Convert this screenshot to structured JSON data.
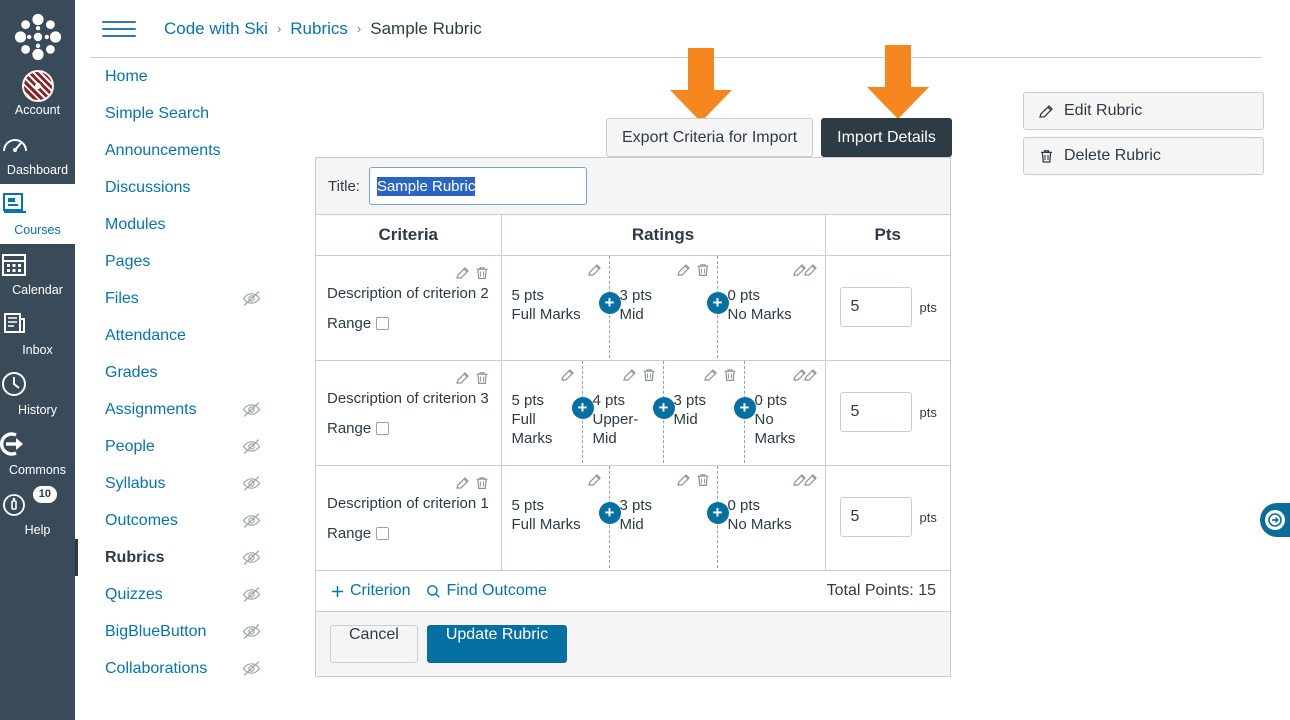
{
  "global_nav": {
    "logo": "canvas-logo",
    "items": [
      {
        "label": "Account",
        "icon": "avatar-icon",
        "active": false,
        "badge": null
      },
      {
        "label": "Dashboard",
        "icon": "dashboard-icon",
        "active": false,
        "badge": null
      },
      {
        "label": "Courses",
        "icon": "courses-icon",
        "active": true,
        "badge": null
      },
      {
        "label": "Calendar",
        "icon": "calendar-icon",
        "active": false,
        "badge": null
      },
      {
        "label": "Inbox",
        "icon": "inbox-icon",
        "active": false,
        "badge": null
      },
      {
        "label": "History",
        "icon": "clock-icon",
        "active": false,
        "badge": null
      },
      {
        "label": "Commons",
        "icon": "commons-arrow-icon",
        "active": false,
        "badge": null
      },
      {
        "label": "Help",
        "icon": "help-icon",
        "active": false,
        "badge": "10"
      }
    ]
  },
  "course_nav": {
    "items": [
      {
        "label": "Home",
        "hidden_icon": false,
        "active": false
      },
      {
        "label": "Simple Search",
        "hidden_icon": false,
        "active": false
      },
      {
        "label": "Announcements",
        "hidden_icon": false,
        "active": false
      },
      {
        "label": "Discussions",
        "hidden_icon": false,
        "active": false
      },
      {
        "label": "Modules",
        "hidden_icon": false,
        "active": false
      },
      {
        "label": "Pages",
        "hidden_icon": false,
        "active": false
      },
      {
        "label": "Files",
        "hidden_icon": true,
        "active": false
      },
      {
        "label": "Attendance",
        "hidden_icon": false,
        "active": false
      },
      {
        "label": "Grades",
        "hidden_icon": false,
        "active": false
      },
      {
        "label": "Assignments",
        "hidden_icon": true,
        "active": false
      },
      {
        "label": "People",
        "hidden_icon": true,
        "active": false
      },
      {
        "label": "Syllabus",
        "hidden_icon": true,
        "active": false
      },
      {
        "label": "Outcomes",
        "hidden_icon": true,
        "active": false
      },
      {
        "label": "Rubrics",
        "hidden_icon": true,
        "active": true
      },
      {
        "label": "Quizzes",
        "hidden_icon": true,
        "active": false
      },
      {
        "label": "BigBlueButton",
        "hidden_icon": true,
        "active": false
      },
      {
        "label": "Collaborations",
        "hidden_icon": true,
        "active": false
      }
    ]
  },
  "header": {
    "menu_icon": "hamburger-icon",
    "breadcrumb": [
      {
        "label": "Code with Ski",
        "current": false
      },
      {
        "label": "Rubrics",
        "current": false
      },
      {
        "label": "Sample Rubric",
        "current": true
      }
    ],
    "separator": "›"
  },
  "side_actions": {
    "edit_label": "Edit Rubric",
    "delete_label": "Delete Rubric"
  },
  "io_buttons": {
    "export_label": "Export Criteria for Import",
    "import_label": "Import Details"
  },
  "annotations": {
    "arrow_color": "#F6871F",
    "arrows": [
      {
        "points_to": "Export Criteria for Import"
      },
      {
        "points_to": "Import Details"
      }
    ]
  },
  "rubric": {
    "title_label": "Title:",
    "title_value": "Sample Rubric",
    "title_selected": true,
    "columns": [
      "Criteria",
      "Ratings",
      "Pts"
    ],
    "pts_suffix": "pts",
    "range_label": "Range",
    "criteria": [
      {
        "description": "Description of criterion 2",
        "points": "5",
        "range_checked": false,
        "ratings": [
          {
            "points": "5 pts",
            "label": "Full Marks",
            "deletable": false
          },
          {
            "points": "3 pts",
            "label": "Mid",
            "deletable": true
          },
          {
            "points": "0 pts",
            "label": "No Marks",
            "deletable": false
          }
        ]
      },
      {
        "description": "Description of criterion 3",
        "points": "5",
        "range_checked": false,
        "ratings": [
          {
            "points": "5 pts",
            "label": "Full Marks",
            "deletable": false
          },
          {
            "points": "4 pts",
            "label": "Upper-Mid",
            "deletable": true
          },
          {
            "points": "3 pts",
            "label": "Mid",
            "deletable": true
          },
          {
            "points": "0 pts",
            "label": "No Marks",
            "deletable": false
          }
        ]
      },
      {
        "description": "Description of criterion 1",
        "points": "5",
        "range_checked": false,
        "ratings": [
          {
            "points": "5 pts",
            "label": "Full Marks",
            "deletable": false
          },
          {
            "points": "3 pts",
            "label": "Mid",
            "deletable": true
          },
          {
            "points": "0 pts",
            "label": "No Marks",
            "deletable": false
          }
        ]
      }
    ],
    "footer": {
      "add_criterion_label": "Criterion",
      "add_criterion_icon": "plus-icon",
      "find_outcome_label": "Find Outcome",
      "find_outcome_icon": "search-icon",
      "total_points_label": "Total Points: 15"
    },
    "actions": {
      "cancel_label": "Cancel",
      "update_label": "Update Rubric"
    }
  },
  "chat_tab": {
    "icon": "chat-bubble-icon"
  },
  "colors": {
    "brand_blue": "#0374B5",
    "button_blue": "#0770A3",
    "dark_slate": "#2D3B45",
    "nav_bg": "#394B58",
    "accent_orange": "#F6871F",
    "selection_blue": "#2A65C6"
  }
}
